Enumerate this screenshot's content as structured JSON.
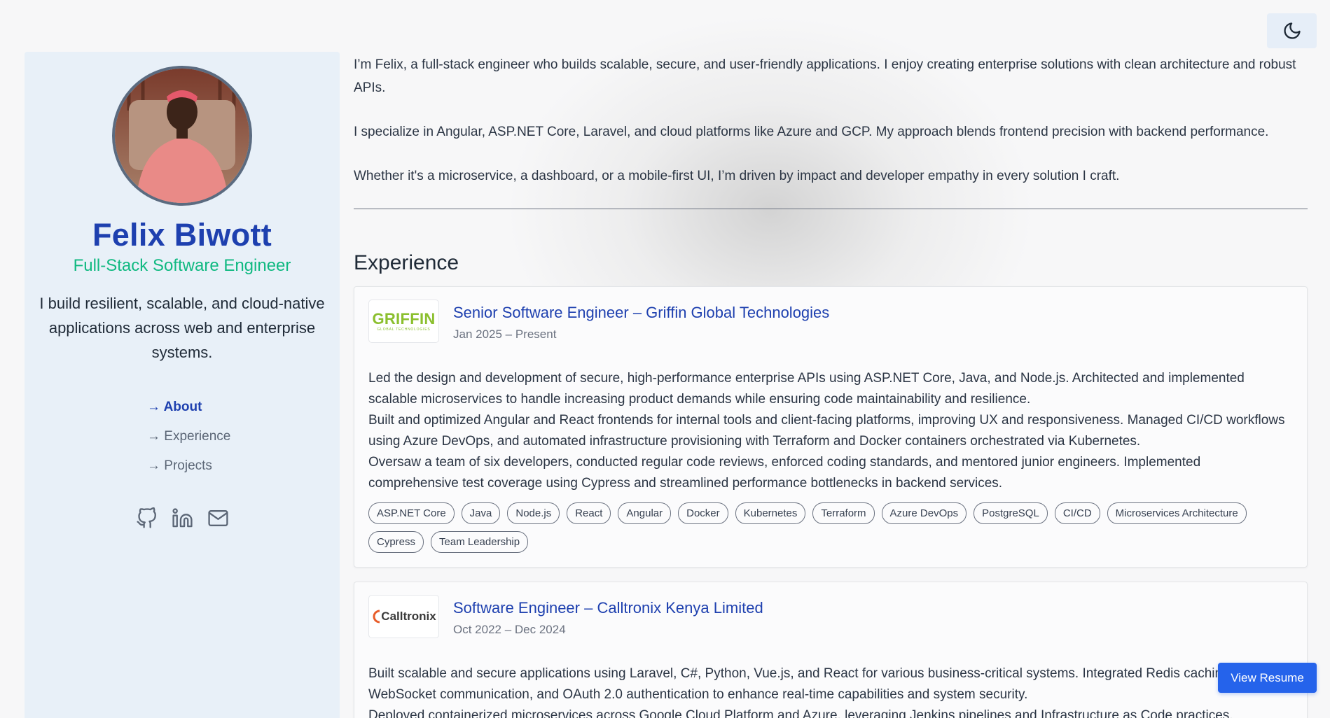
{
  "theme": {
    "icon": "moon-icon"
  },
  "profile": {
    "name": "Felix Biwott",
    "role": "Full-Stack Software Engineer",
    "tagline": "I build resilient, scalable, and cloud-native applications across web and enterprise systems."
  },
  "nav": [
    {
      "label": "→ About",
      "active": true
    },
    {
      "label": "→ Experience",
      "active": false
    },
    {
      "label": "→ Projects",
      "active": false
    }
  ],
  "socials": [
    "github-icon",
    "linkedin-icon",
    "mail-icon"
  ],
  "about": {
    "paragraphs": [
      "I’m Felix, a full-stack engineer who builds scalable, secure, and user-friendly applications. I enjoy creating enterprise solutions with clean architecture and robust APIs.",
      "I specialize in Angular, ASP.NET Core, Laravel, and cloud platforms like Azure and GCP. My approach blends frontend precision with backend performance.",
      "Whether it's a microservice, a dashboard, or a mobile-first UI, I’m driven by impact and developer empathy in every solution I craft."
    ]
  },
  "experience": {
    "title": "Experience",
    "items": [
      {
        "logo": "GRIFFIN",
        "logo_sub": "GLOBAL TECHNOLOGIES",
        "title": "Senior Software Engineer – Griffin Global Technologies",
        "date": "Jan 2025 – Present",
        "description": [
          "Led the design and development of secure, high-performance enterprise APIs using ASP.NET Core, Java, and Node.js. Architected and implemented scalable microservices to handle increasing product demands while ensuring code maintainability and resilience.",
          "Built and optimized Angular and React frontends for internal tools and client-facing platforms, improving UX and responsiveness. Managed CI/CD workflows using Azure DevOps, and automated infrastructure provisioning with Terraform and Docker containers orchestrated via Kubernetes.",
          "Oversaw a team of six developers, conducted regular code reviews, enforced coding standards, and mentored junior engineers. Implemented comprehensive test coverage using Cypress and streamlined performance bottlenecks in backend services."
        ],
        "tags": [
          "ASP.NET Core",
          "Java",
          "Node.js",
          "React",
          "Angular",
          "Docker",
          "Kubernetes",
          "Terraform",
          "Azure DevOps",
          "PostgreSQL",
          "CI/CD",
          "Microservices Architecture",
          "Cypress",
          "Team Leadership"
        ]
      },
      {
        "logo": "Calltronix",
        "title": "Software Engineer – Calltronix Kenya Limited",
        "date": "Oct 2022 – Dec 2024",
        "description": [
          "Built scalable and secure applications using Laravel, C#, Python, Vue.js, and React for various business-critical systems. Integrated Redis caching, WebSocket communication, and OAuth 2.0 authentication to enhance real-time capabilities and system security.",
          "Deployed containerized microservices across Google Cloud Platform and Azure, leveraging Jenkins pipelines and Infrastructure as Code practices."
        ],
        "tags": []
      }
    ]
  },
  "resume_button": "View Resume"
}
